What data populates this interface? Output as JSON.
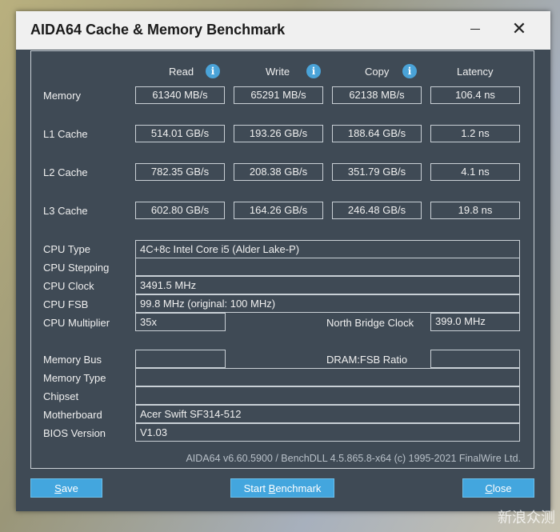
{
  "window": {
    "title": "AIDA64 Cache & Memory Benchmark",
    "close_glyph": "✕"
  },
  "columns": {
    "read": "Read",
    "write": "Write",
    "copy": "Copy",
    "latency": "Latency",
    "info_glyph": "i"
  },
  "rows": [
    {
      "label": "Memory",
      "read": "61340 MB/s",
      "write": "65291 MB/s",
      "copy": "62138 MB/s",
      "latency": "106.4 ns"
    },
    {
      "label": "L1 Cache",
      "read": "514.01 GB/s",
      "write": "193.26 GB/s",
      "copy": "188.64 GB/s",
      "latency": "1.2 ns"
    },
    {
      "label": "L2 Cache",
      "read": "782.35 GB/s",
      "write": "208.38 GB/s",
      "copy": "351.79 GB/s",
      "latency": "4.1 ns"
    },
    {
      "label": "L3 Cache",
      "read": "602.80 GB/s",
      "write": "164.26 GB/s",
      "copy": "246.48 GB/s",
      "latency": "19.8 ns"
    }
  ],
  "cpu": {
    "type_label": "CPU Type",
    "type_value": "4C+8c Intel Core i5  (Alder Lake-P)",
    "stepping_label": "CPU Stepping",
    "stepping_value": "",
    "clock_label": "CPU Clock",
    "clock_value": "3491.5 MHz",
    "fsb_label": "CPU FSB",
    "fsb_value": "99.8 MHz  (original: 100 MHz)",
    "multiplier_label": "CPU Multiplier",
    "multiplier_value": "35x",
    "nb_clock_label": "North Bridge Clock",
    "nb_clock_value": "399.0 MHz"
  },
  "system": {
    "membus_label": "Memory Bus",
    "membus_value": "",
    "dram_fsb_label": "DRAM:FSB Ratio",
    "dram_fsb_value": "",
    "memtype_label": "Memory Type",
    "memtype_value": "",
    "chipset_label": "Chipset",
    "chipset_value": "",
    "motherboard_label": "Motherboard",
    "motherboard_value": "Acer Swift SF314-512",
    "bios_label": "BIOS Version",
    "bios_value": "V1.03"
  },
  "footer": "AIDA64 v6.60.5900 / BenchDLL 4.5.865.8-x64  (c) 1995-2021 FinalWire Ltd.",
  "buttons": {
    "save_first": "S",
    "save_rest": "ave",
    "start_pre": "Start ",
    "start_ul": "B",
    "start_rest": "enchmark",
    "close_first": "C",
    "close_rest": "lose"
  },
  "watermark": "新浪众测"
}
